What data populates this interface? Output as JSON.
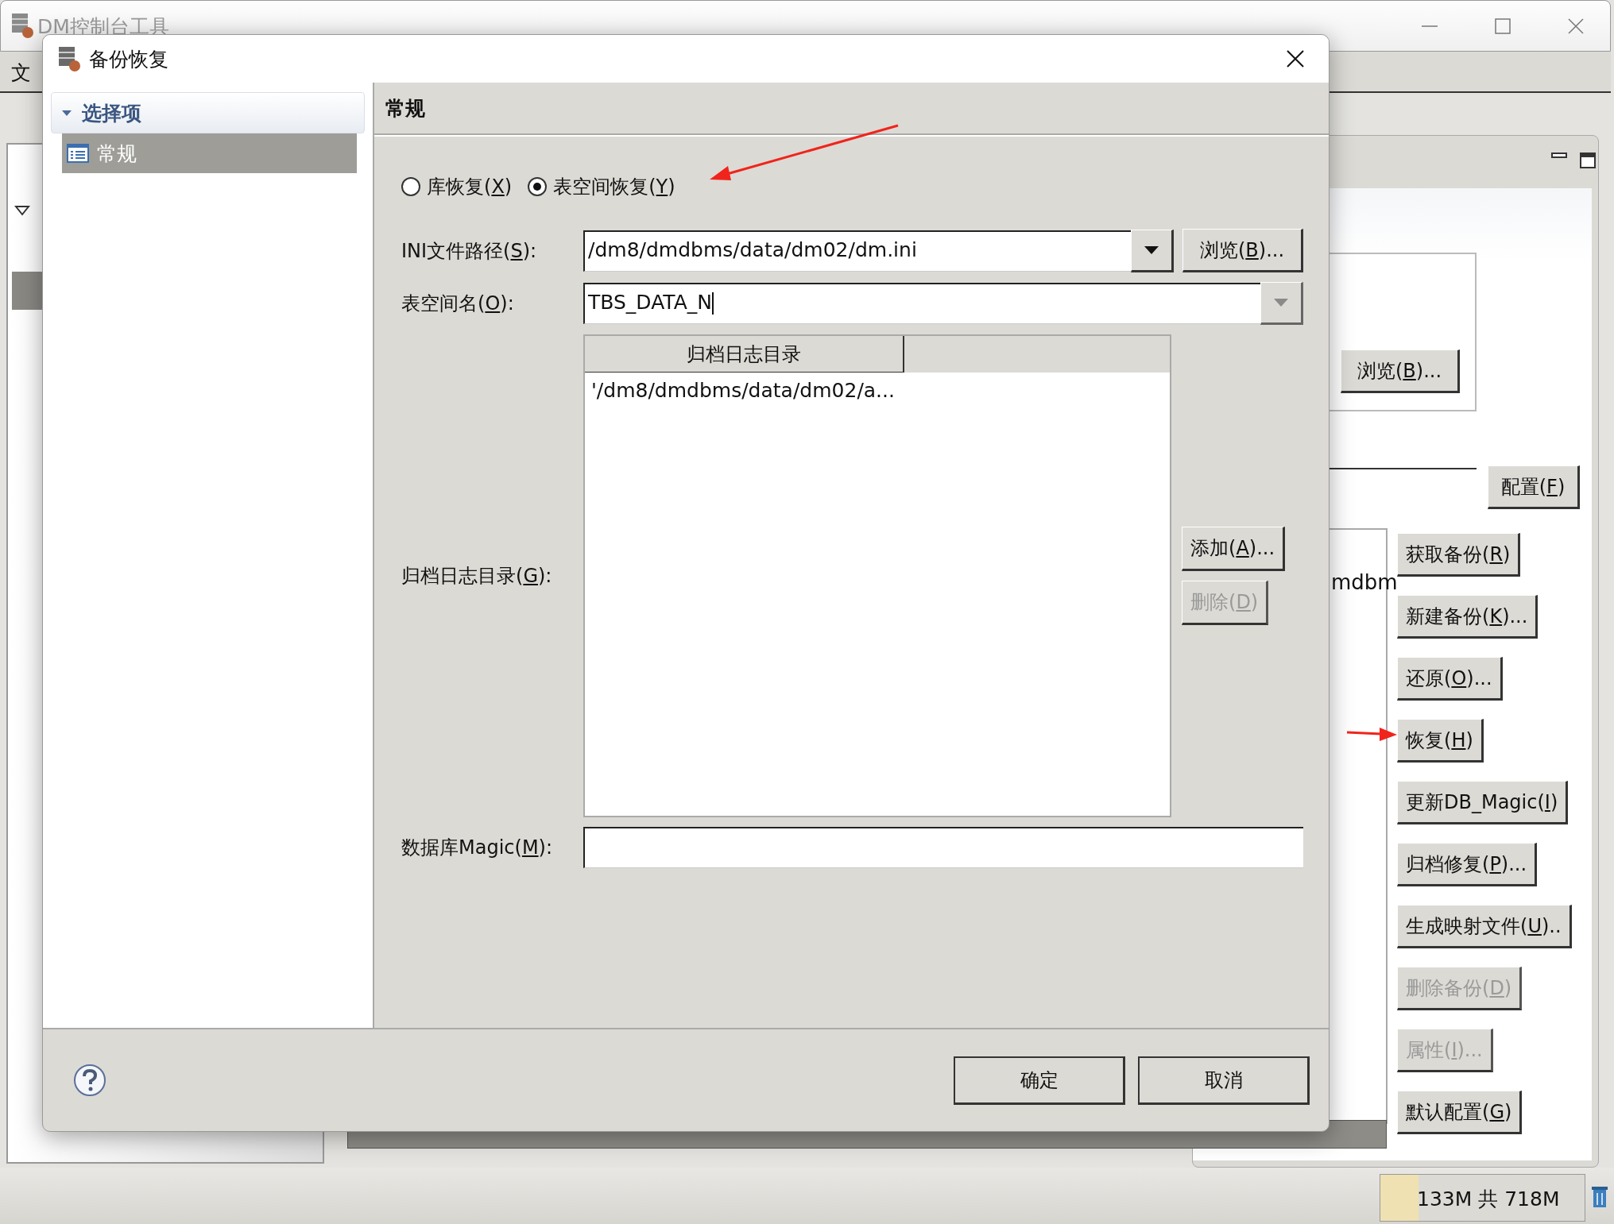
{
  "main_window": {
    "title": "DM控制台工具",
    "menu": [
      "文"
    ],
    "browse_button": "浏览(B)...",
    "config_button": "配置(F)",
    "list_text": "mdbm",
    "buttons": [
      {
        "label": "获取备份(R)",
        "disabled": false
      },
      {
        "label": "新建备份(K)...",
        "disabled": false
      },
      {
        "label": "还原(O)...",
        "disabled": false
      },
      {
        "label": "恢复(H)",
        "disabled": false
      },
      {
        "label": "更新DB_Magic(I)",
        "disabled": false
      },
      {
        "label": "归档修复(P)...",
        "disabled": false
      },
      {
        "label": "生成映射文件(U)..",
        "disabled": false
      },
      {
        "label": "删除备份(D)",
        "disabled": true
      },
      {
        "label": "属性(I)...",
        "disabled": true
      },
      {
        "label": "默认配置(G)",
        "disabled": false
      }
    ],
    "memory": {
      "text": "133M 共 718M",
      "level": 0.185
    }
  },
  "dialog": {
    "title": "备份恢复",
    "tree": {
      "label": "选择项",
      "expanded": true,
      "children": [
        {
          "label": "常规",
          "selected": true
        }
      ]
    },
    "page_title": "常规",
    "radios": [
      {
        "label": "库恢复(X)",
        "selected": false
      },
      {
        "label": "表空间恢复(Y)",
        "selected": true
      }
    ],
    "ini_label": "INI文件路径(S):",
    "ini_value": "/dm8/dmdbms/data/dm02/dm.ini",
    "ini_browse": "浏览(B)...",
    "tablespace_label": "表空间名(O):",
    "tablespace_value": "TBS_DATA_N",
    "archive_label": "归档日志目录(G):",
    "archive_table": {
      "columns": [
        "归档日志目录"
      ],
      "rows": [
        [
          "'/dm8/dmdbms/data/dm02/a..."
        ]
      ]
    },
    "add_button": {
      "label": "添加(A)...",
      "disabled": false
    },
    "delete_button": {
      "label": "删除(D)",
      "disabled": true
    },
    "magic_label": "数据库Magic(M):",
    "ok_button": "确定",
    "cancel_button": "取消"
  }
}
